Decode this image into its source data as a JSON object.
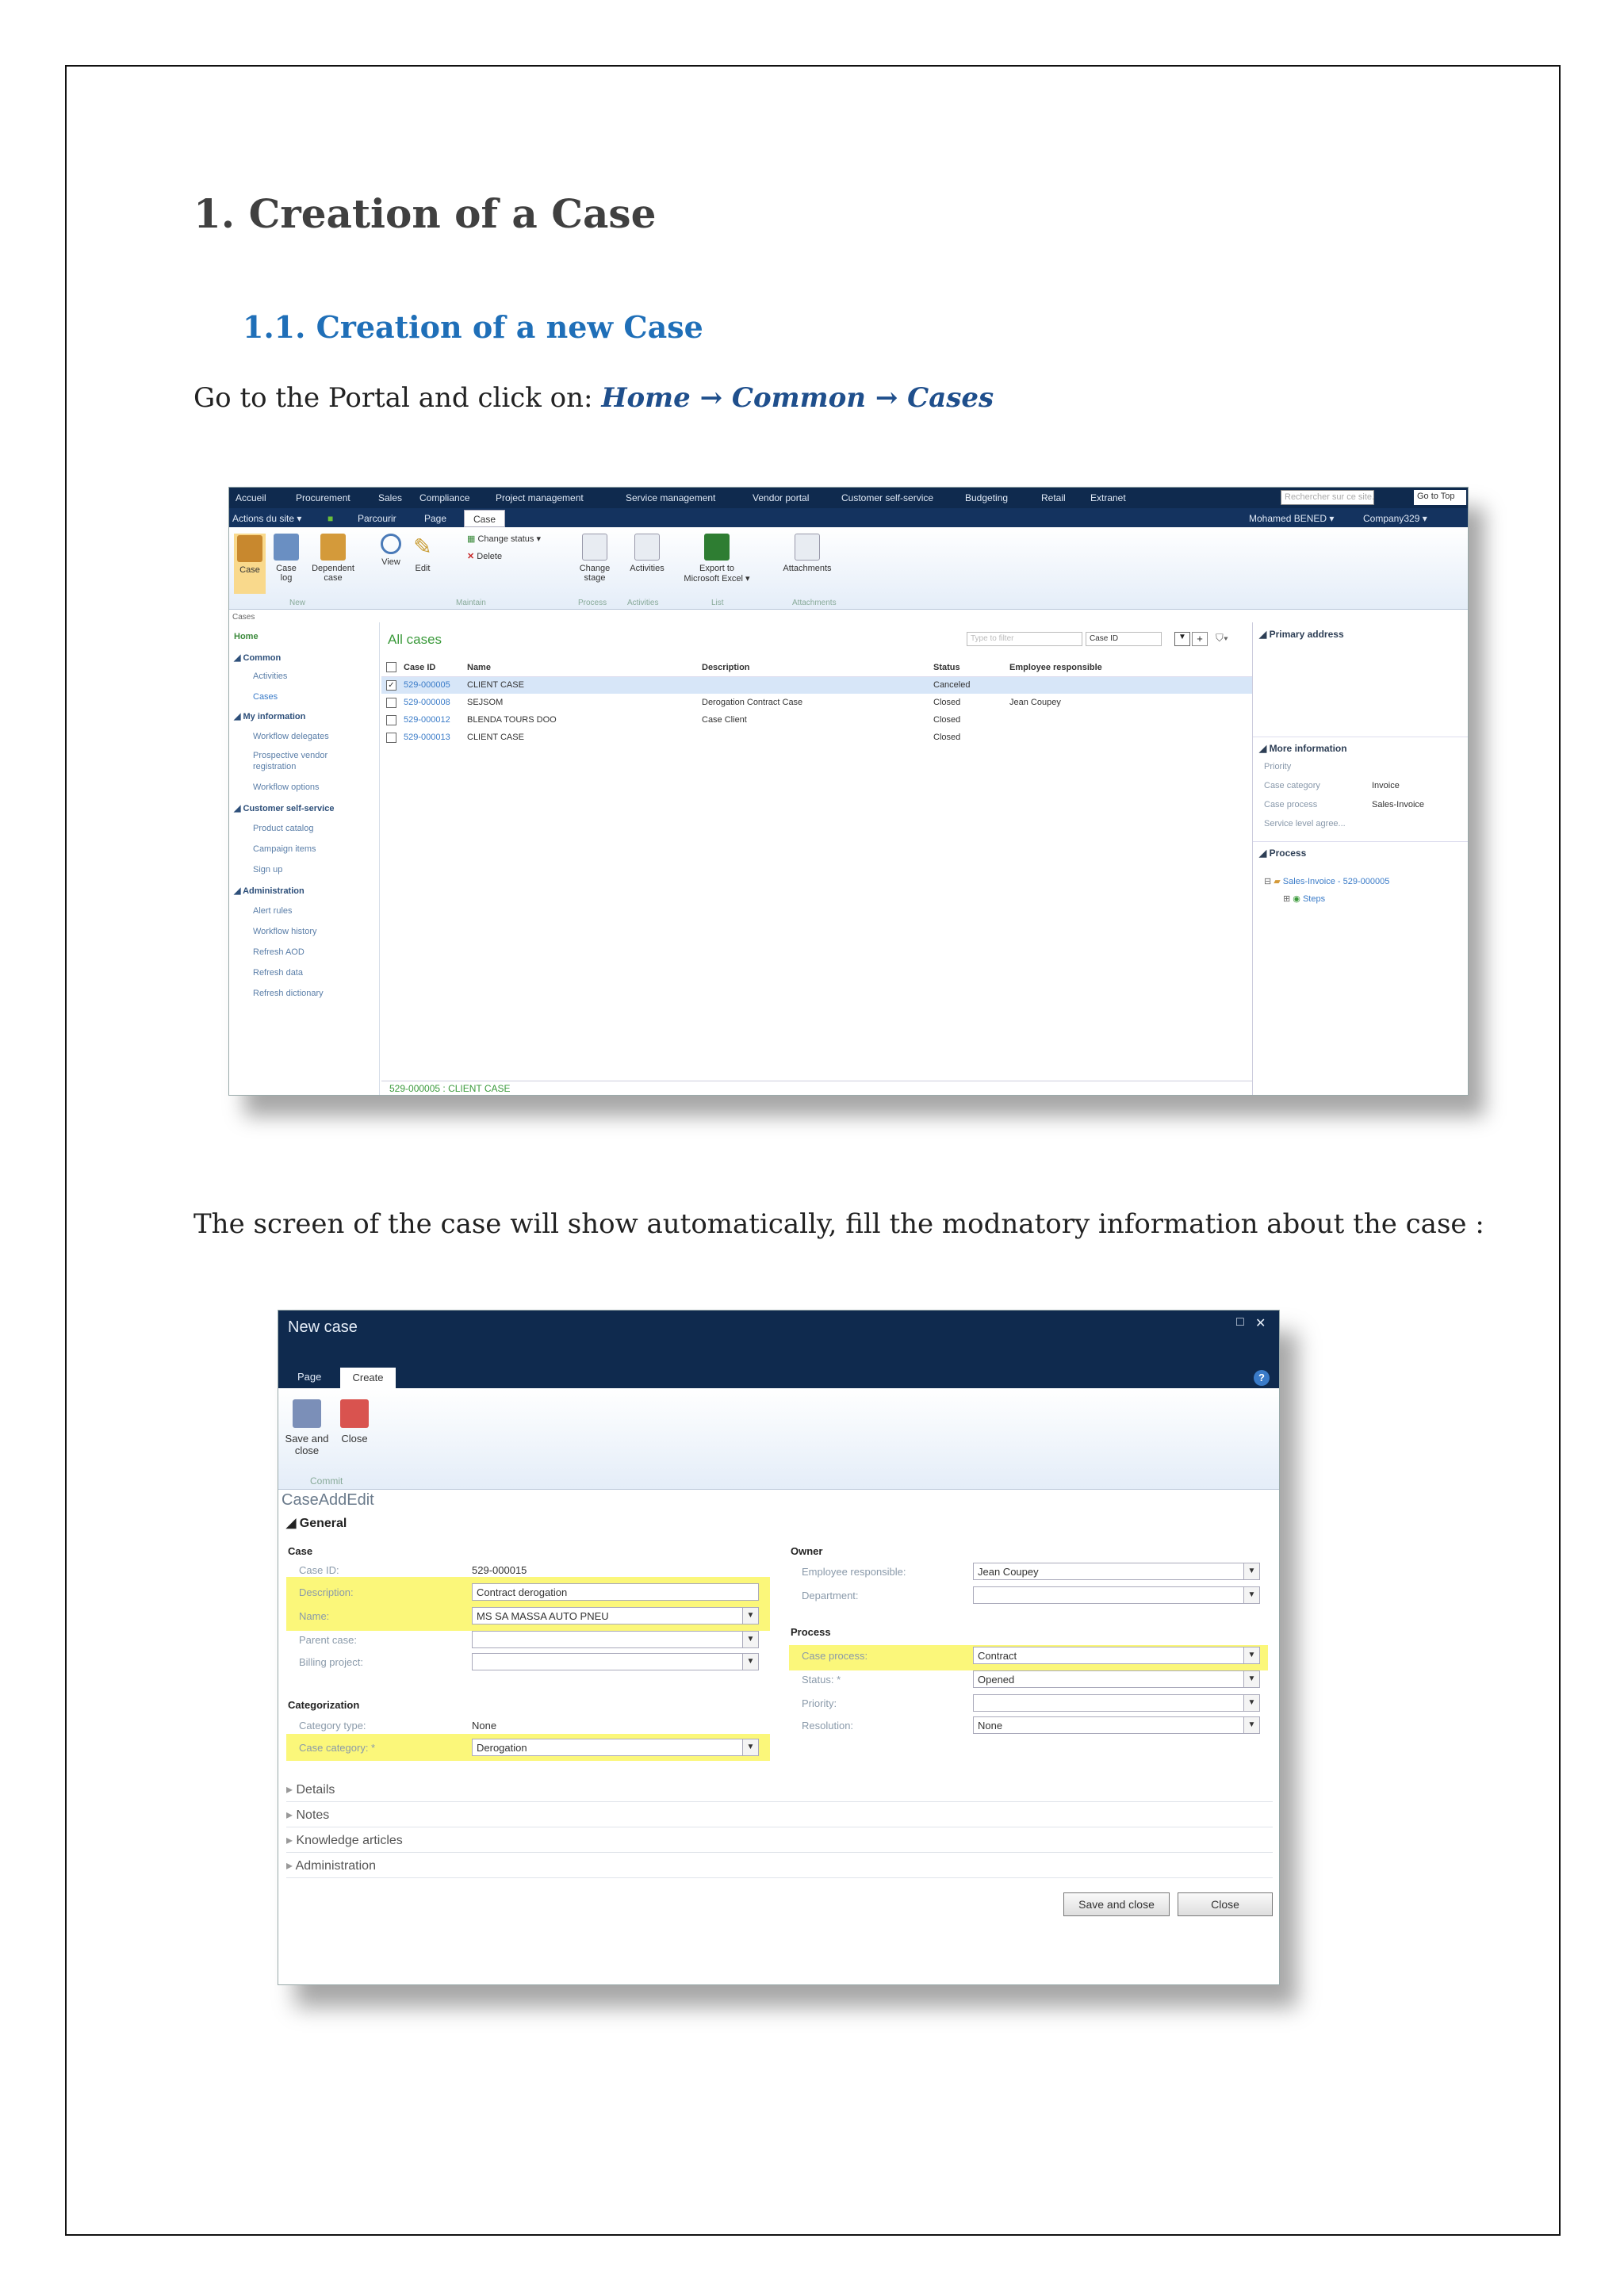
{
  "document": {
    "heading1": "1. Creation of a Case",
    "heading2": "1.1. Creation of a new Case",
    "instruction_prefix": "Go to the Portal and click on: ",
    "nav_path": "Home → Common → Cases",
    "instruction2": "The screen of the case will show automatically, fill the modnatory information about the case :"
  },
  "portal": {
    "top_nav": [
      "Accueil",
      "Procurement",
      "Sales",
      "Compliance",
      "Project management",
      "Service management",
      "Vendor portal",
      "Customer self-service",
      "Budgeting",
      "Retail",
      "Extranet"
    ],
    "search_placeholder": "Rechercher sur ce site...",
    "goto_label": "Go to Top",
    "site_actions": "Actions du site ▾",
    "browse_tab": "Parcourir",
    "page_tab": "Page",
    "case_tab": "Case",
    "user": "Mohamed BENED ▾",
    "company": "Company329 ▾",
    "ribbon": {
      "case": "Case",
      "case_log": "Case log",
      "dependent_case": "Dependent case",
      "view": "View",
      "edit": "Edit",
      "change_status": "Change status ▾",
      "delete": "Delete",
      "change_stage": "Change stage",
      "activities": "Activities",
      "export_excel": "Export to Microsoft Excel ▾",
      "attachments": "Attachments",
      "groups": [
        "New",
        "Maintain",
        "Process",
        "Activities",
        "List",
        "Attachments"
      ]
    },
    "breadcrumb": "Cases",
    "left_nav": {
      "home": "Home",
      "common": "◢ Common",
      "activities": "Activities",
      "cases": "Cases",
      "my_information": "◢ My information",
      "workflow_delegates": "Workflow delegates",
      "prospective_vendor_1": "Prospective vendor",
      "prospective_vendor_2": "registration",
      "workflow_options": "Workflow options",
      "customer_self_service": "◢ Customer self-service",
      "product_catalog": "Product catalog",
      "campaign_items": "Campaign items",
      "sign_up": "Sign up",
      "administration": "◢ Administration",
      "alert_rules": "Alert rules",
      "workflow_history": "Workflow history",
      "refresh_aod": "Refresh AOD",
      "refresh_data": "Refresh data",
      "refresh_dictionary": "Refresh dictionary"
    },
    "grid": {
      "title": "All cases",
      "search_placeholder": "Type to filter",
      "search_field": "Case ID",
      "columns": [
        "Case ID",
        "Name",
        "Description",
        "Status",
        "Employee responsible"
      ],
      "rows": [
        {
          "id": "529-000005",
          "name": "CLIENT CASE",
          "description": "",
          "status": "Canceled",
          "employee": "",
          "selected": true
        },
        {
          "id": "529-000008",
          "name": "SEJSOM",
          "description": "Derogation Contract Case",
          "status": "Closed",
          "employee": "Jean Coupey",
          "selected": false
        },
        {
          "id": "529-000012",
          "name": "BLENDA TOURS DOO",
          "description": "Case Client",
          "status": "Closed",
          "employee": "",
          "selected": false
        },
        {
          "id": "529-000013",
          "name": "CLIENT CASE",
          "description": "",
          "status": "Closed",
          "employee": "",
          "selected": false
        }
      ],
      "footer": "529-000005 : CLIENT CASE"
    },
    "right_panel": {
      "primary_address": "◢ Primary address",
      "more_information": "◢ More information",
      "priority_label": "Priority",
      "case_category_label": "Case category",
      "case_category_value": "Invoice",
      "case_process_label": "Case process",
      "case_process_value": "Sales-Invoice",
      "sla_label": "Service level agree...",
      "process_header": "◢ Process",
      "process_item": "Sales-Invoice - 529-000005",
      "steps": "Steps"
    }
  },
  "dialog": {
    "title": "New case",
    "tabs": [
      "Page",
      "Create"
    ],
    "save_and_close_icon_label": "Save and close",
    "close_icon_label": "Close",
    "commit_group": "Commit",
    "form_title": "CaseAddEdit",
    "general": "◢ General",
    "case_section": "Case",
    "case_id_label": "Case ID:",
    "case_id_value": "529-000015",
    "description_label": "Description:",
    "description_value": "Contract derogation",
    "name_label": "Name:",
    "name_value": "MS SA MASSA AUTO PNEU",
    "parent_case_label": "Parent case:",
    "billing_project_label": "Billing project:",
    "categorization_section": "Categorization",
    "category_type_label": "Category type:",
    "category_type_value": "None",
    "case_category_label": "Case category: *",
    "case_category_value": "Derogation",
    "owner_section": "Owner",
    "employee_responsible_label": "Employee responsible:",
    "employee_responsible_value": "Jean Coupey",
    "department_label": "Department:",
    "process_section": "Process",
    "case_process_label": "Case process:",
    "case_process_value": "Contract",
    "status_label": "Status: *",
    "status_value": "Opened",
    "priority_label": "Priority:",
    "resolution_label": "Resolution:",
    "resolution_value": "None",
    "collapsed_sections": [
      "Details",
      "Notes",
      "Knowledge articles",
      "Administration"
    ],
    "save_and_close_button": "Save and close",
    "close_button": "Close"
  },
  "colors": {
    "portal_nav": "#0f2a4e",
    "highlight": "#fbf77a",
    "heading2": "#1f6fb8",
    "link": "#3a7bc8"
  }
}
